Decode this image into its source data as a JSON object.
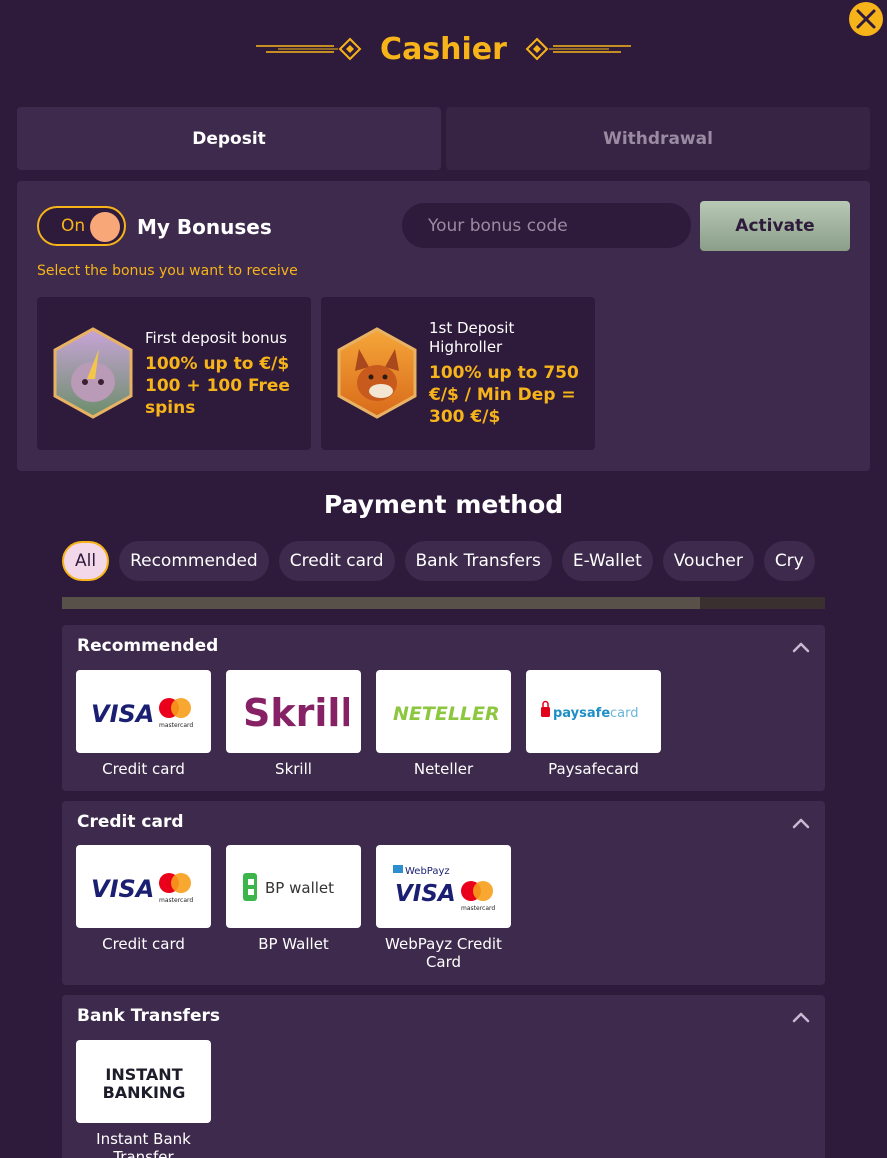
{
  "header": {
    "title": "Cashier"
  },
  "tabs": [
    {
      "label": "Deposit",
      "active": true
    },
    {
      "label": "Withdrawal",
      "active": false
    }
  ],
  "bonus": {
    "toggle_label": "On",
    "my_bonuses": "My Bonuses",
    "code_placeholder": "Your bonus code",
    "activate_label": "Activate",
    "hint": "Select the bonus you want to receive",
    "cards": [
      {
        "name": "First deposit bonus",
        "offer": "100% up to €/$ 100 + 100 Free spins"
      },
      {
        "name": "1st Deposit Highroller",
        "offer": "100% up to 750 €/$ / Min Dep = 300 €/$"
      }
    ]
  },
  "payment": {
    "title": "Payment method",
    "filters": [
      "All",
      "Recommended",
      "Credit card",
      "Bank Transfers",
      "E-Wallet",
      "Voucher",
      "Cry"
    ],
    "sections": [
      {
        "title": "Recommended",
        "methods": [
          {
            "label": "Credit card",
            "logo": "visa-mastercard"
          },
          {
            "label": "Skrill",
            "logo": "skrill"
          },
          {
            "label": "Neteller",
            "logo": "neteller"
          },
          {
            "label": "Paysafecard",
            "logo": "paysafecard"
          }
        ]
      },
      {
        "title": "Credit card",
        "methods": [
          {
            "label": "Credit card",
            "logo": "visa-mastercard"
          },
          {
            "label": "BP Wallet",
            "logo": "bp-wallet"
          },
          {
            "label": "WebPayz Credit Card",
            "logo": "webpayz"
          }
        ]
      },
      {
        "title": "Bank Transfers",
        "methods": [
          {
            "label": "Instant Bank Transfer",
            "logo": "instant-banking"
          }
        ]
      }
    ]
  },
  "logos": {
    "visa": "VISA",
    "mastercard": "mastercard",
    "skrill": "Skrill",
    "neteller": "NETELLER",
    "paysafe": "paysafe",
    "card": "card",
    "bp": "BP wallet",
    "webpayz": "WebPayz",
    "instant1": "INSTANT",
    "instant2": "BANKING"
  },
  "colors": {
    "accent": "#f7b41a",
    "background": "#2e1a3a",
    "panel": "#3e2a4c"
  }
}
